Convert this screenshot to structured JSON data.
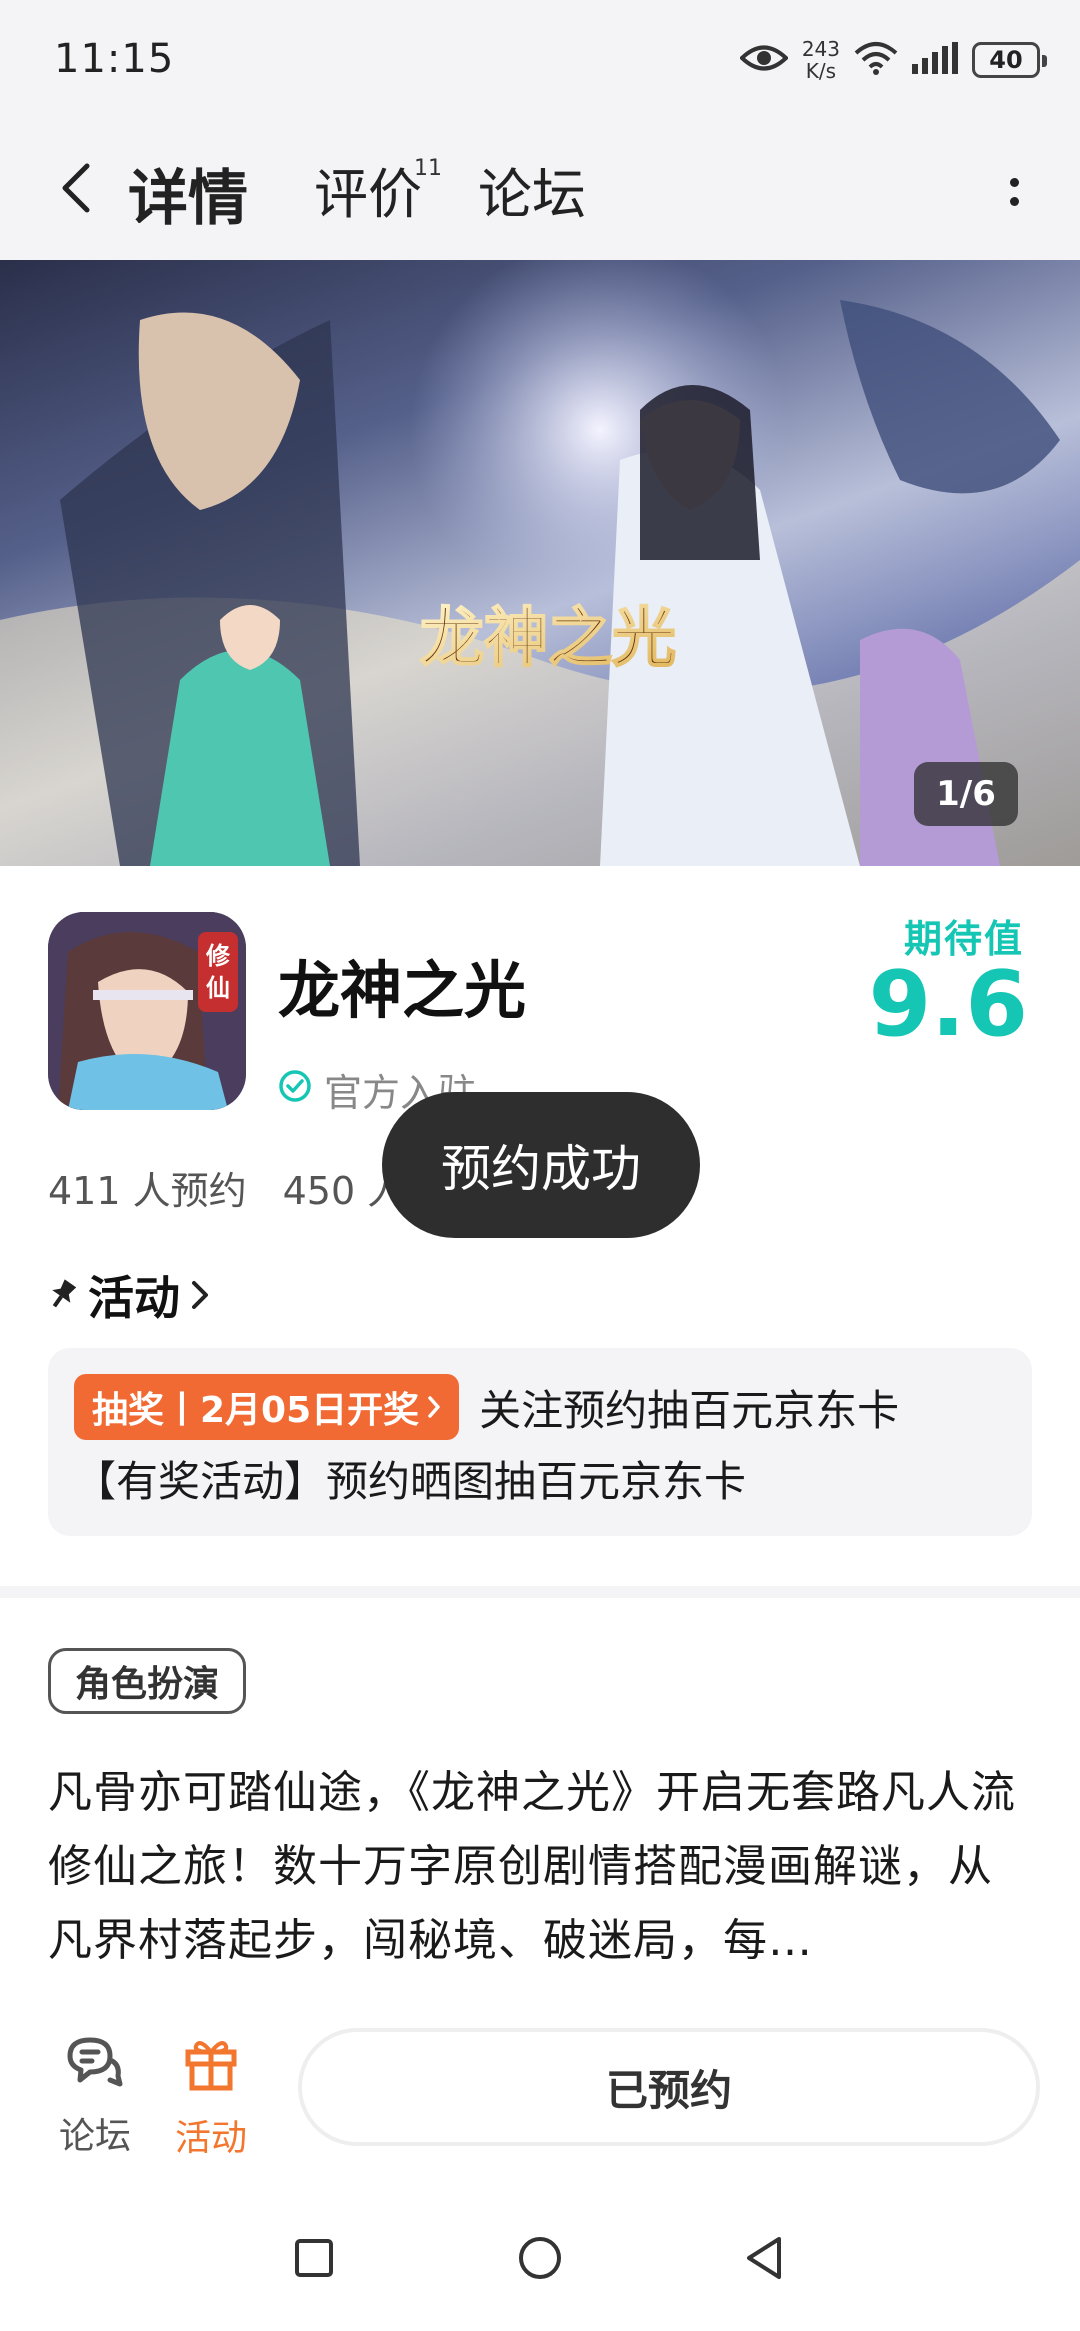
{
  "status_bar": {
    "time": "11:15",
    "net_speed_value": "243",
    "net_speed_unit": "K/s",
    "battery": "40"
  },
  "header": {
    "tabs": [
      {
        "label": "详情",
        "active": true
      },
      {
        "label": "评价",
        "count": "11"
      },
      {
        "label": "论坛"
      }
    ]
  },
  "banner": {
    "counter": "1/6",
    "logo_text": "龙神之光"
  },
  "game": {
    "title": "龙神之光",
    "official_label": "官方入驻",
    "expect_label": "期待值",
    "expect_score": "9.6",
    "reservations": "411 人预约",
    "followers": "450 人",
    "icon_badge": "修仙"
  },
  "toast": "预约成功",
  "activity": {
    "heading": "活动",
    "lottery_badge": "抽奖丨2月05日开奖",
    "lottery_text": "关注预约抽百元京东卡",
    "second_text": "【有奖活动】预约晒图抽百元京东卡"
  },
  "genre_tag": "角色扮演",
  "description": "凡骨亦可踏仙途，《龙神之光》开启无套路凡人流修仙之旅！数十万字原创剧情搭配漫画解谜，从凡界村落起步，闯秘境、破迷局，每…",
  "bottom_bar": {
    "forum_label": "论坛",
    "activity_label": "活动",
    "reserved_label": "已预约"
  },
  "colors": {
    "accent_teal": "#14c6b3",
    "accent_orange": "#f26a33",
    "toast_bg": "#2e2e2e"
  },
  "icons": [
    "eye-icon",
    "wifi-icon",
    "signal-icon",
    "battery-icon",
    "back-icon",
    "more-icon",
    "verified-icon",
    "pin-icon",
    "chevron-right-icon",
    "forum-chat-icon",
    "gift-icon",
    "square-icon",
    "circle-icon",
    "triangle-back-icon"
  ]
}
